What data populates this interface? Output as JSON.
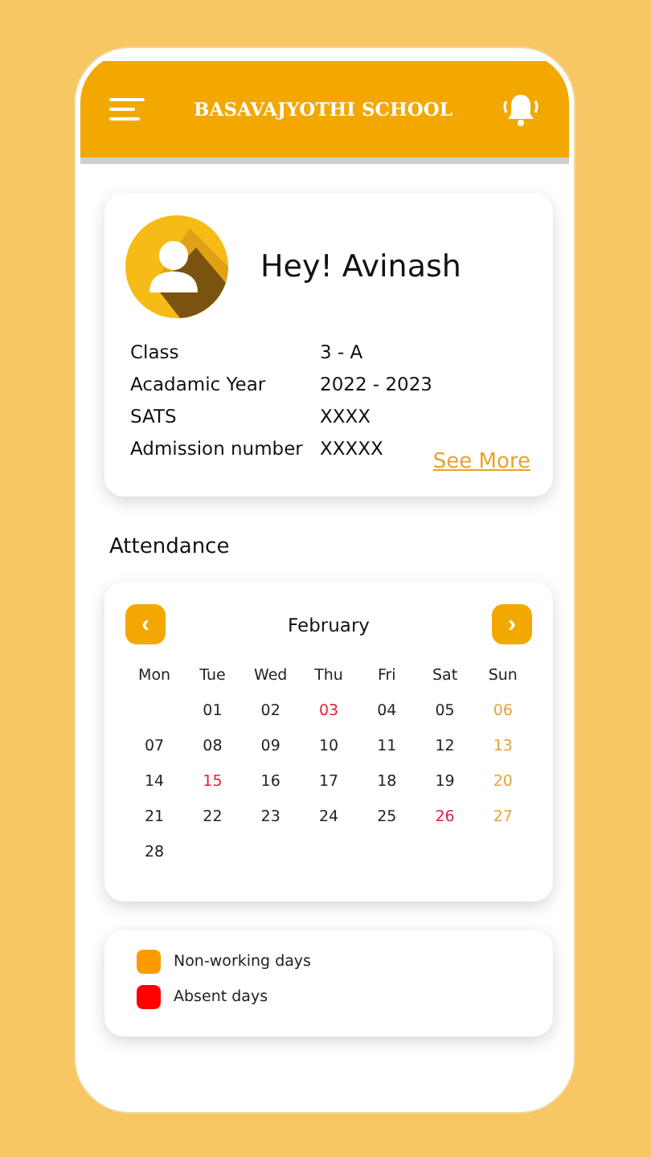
{
  "header": {
    "title": "BASAVAJYOTHI SCHOOL"
  },
  "profile": {
    "greeting": "Hey! Avinash",
    "fields": [
      {
        "label": "Class",
        "value": "3 - A"
      },
      {
        "label": "Acadamic Year",
        "value": "2022 - 2023"
      },
      {
        "label": "SATS",
        "value": "XXXX"
      },
      {
        "label": "Admission number",
        "value": "XXXXX"
      }
    ],
    "link": "See More"
  },
  "attendance": {
    "heading": "Attendance",
    "month": "February",
    "prev": "‹",
    "next": "›",
    "weekdays": [
      "Mon",
      "Tue",
      "Wed",
      "Thu",
      "Fri",
      "Sat",
      "Sun"
    ],
    "weeks": [
      {
        "starts_midweek": true,
        "days": [
          {
            "label": "01",
            "kind": "present"
          },
          {
            "label": "02",
            "kind": "present"
          },
          {
            "label": "03",
            "kind": "absent"
          },
          {
            "label": "04",
            "kind": "present"
          },
          {
            "label": "05",
            "kind": "present"
          },
          {
            "label": "06",
            "kind": "holiday"
          }
        ]
      },
      {
        "days": [
          {
            "label": "07",
            "kind": "present"
          },
          {
            "label": "08",
            "kind": "present"
          },
          {
            "label": "09",
            "kind": "present"
          },
          {
            "label": "10",
            "kind": "present"
          },
          {
            "label": "11",
            "kind": "present"
          },
          {
            "label": "12",
            "kind": "present"
          },
          {
            "label": "13",
            "kind": "holiday"
          }
        ]
      },
      {
        "days": [
          {
            "label": "14",
            "kind": "present"
          },
          {
            "label": "15",
            "kind": "absent"
          },
          {
            "label": "16",
            "kind": "present"
          },
          {
            "label": "17",
            "kind": "present"
          },
          {
            "label": "18",
            "kind": "present"
          },
          {
            "label": "19",
            "kind": "present"
          },
          {
            "label": "20",
            "kind": "holiday"
          }
        ]
      },
      {
        "days": [
          {
            "label": "21",
            "kind": "present"
          },
          {
            "label": "22",
            "kind": "present"
          },
          {
            "label": "23",
            "kind": "present"
          },
          {
            "label": "24",
            "kind": "present"
          },
          {
            "label": "25",
            "kind": "present"
          },
          {
            "label": "26",
            "kind": "absent"
          },
          {
            "label": "27",
            "kind": "holiday"
          }
        ]
      },
      {
        "days": [
          {
            "label": "28",
            "kind": "present"
          }
        ]
      }
    ]
  },
  "legend": [
    {
      "label": "Non-working days",
      "color": "#ff9a00"
    },
    {
      "label": "Absent days",
      "color": "#ff0000"
    }
  ]
}
